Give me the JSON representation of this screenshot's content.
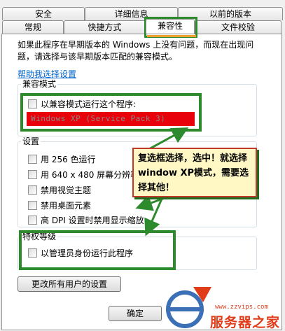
{
  "tabs_back": [
    "安全",
    "详细信息",
    "以前的版本"
  ],
  "tabs_front": [
    "常规",
    "快捷方式",
    "兼容性",
    "文件校验"
  ],
  "active_tab": "兼容性",
  "intro_text": "如果此程序在早期版本的 Windows 上没有问题，而现在出现问题，请选择与该早期版本匹配的兼容模式。",
  "help_link": "帮助我选择设置",
  "compat_group": {
    "title": "兼容模式",
    "checkbox_label": "以兼容模式运行这个程序:",
    "select_value": "Windows XP (Service Pack 3)"
  },
  "settings_group": {
    "title": "设置",
    "items": [
      "用 256 色运行",
      "用 640 x 480 屏幕分辨率",
      "禁用视觉主题",
      "禁用桌面元素",
      "高 DPI 设置时禁用显示缩放"
    ]
  },
  "privilege_group": {
    "title": "特权等级",
    "checkbox_label": "以管理员身份运行此程序"
  },
  "change_all_button": "更改所有用户的设置",
  "ok_button": "确定",
  "callout_text": "复选框选择，选中！就选择window XP模式，需要选择其他！",
  "watermark": {
    "url": "www.zzvips.com",
    "name": "服务器之家"
  },
  "colors": {
    "highlight_red": "#e8000b",
    "annotation_green": "#2d8a2d",
    "link_blue": "#0066cc",
    "watermark_red": "#e03c1a"
  }
}
